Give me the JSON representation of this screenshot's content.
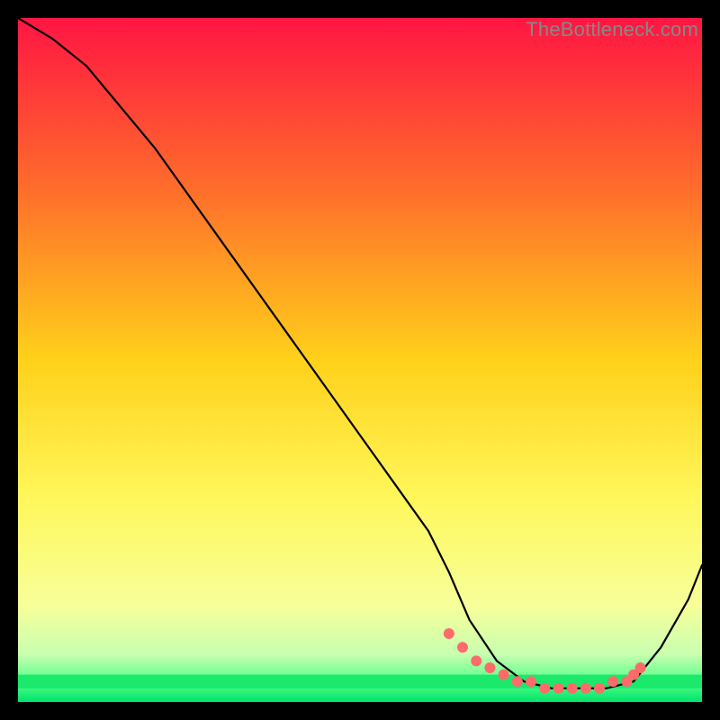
{
  "watermark": "TheBottleneck.com",
  "chart_data": {
    "type": "line",
    "title": "",
    "xlabel": "",
    "ylabel": "",
    "xlim": [
      0,
      100
    ],
    "ylim": [
      0,
      100
    ],
    "grid": false,
    "legend": false,
    "gradient_stops": [
      {
        "offset": 0.0,
        "color": "#ff1543"
      },
      {
        "offset": 0.25,
        "color": "#ff6d2b"
      },
      {
        "offset": 0.5,
        "color": "#ffd11a"
      },
      {
        "offset": 0.7,
        "color": "#fff75a"
      },
      {
        "offset": 0.86,
        "color": "#f7ff9a"
      },
      {
        "offset": 0.93,
        "color": "#c8ffb0"
      },
      {
        "offset": 0.97,
        "color": "#57ff8a"
      },
      {
        "offset": 1.0,
        "color": "#00e46a"
      }
    ],
    "series": [
      {
        "name": "bottleneck-curve",
        "x": [
          0,
          5,
          10,
          15,
          20,
          25,
          30,
          35,
          40,
          45,
          50,
          55,
          60,
          63,
          66,
          70,
          74,
          78,
          82,
          86,
          90,
          94,
          98,
          100
        ],
        "y": [
          100,
          97,
          93,
          87,
          81,
          74,
          67,
          60,
          53,
          46,
          39,
          32,
          25,
          19,
          12,
          6,
          3,
          2,
          2,
          2,
          3,
          8,
          15,
          20
        ]
      }
    ],
    "markers": {
      "name": "highlight-dots",
      "color": "#ff6b6b",
      "radius": 6,
      "x": [
        63,
        65,
        67,
        69,
        71,
        73,
        75,
        77,
        79,
        81,
        83,
        85,
        87,
        89,
        90,
        91
      ],
      "y": [
        10,
        8,
        6,
        5,
        4,
        3,
        3,
        2,
        2,
        2,
        2,
        2,
        3,
        3,
        4,
        5
      ]
    }
  }
}
